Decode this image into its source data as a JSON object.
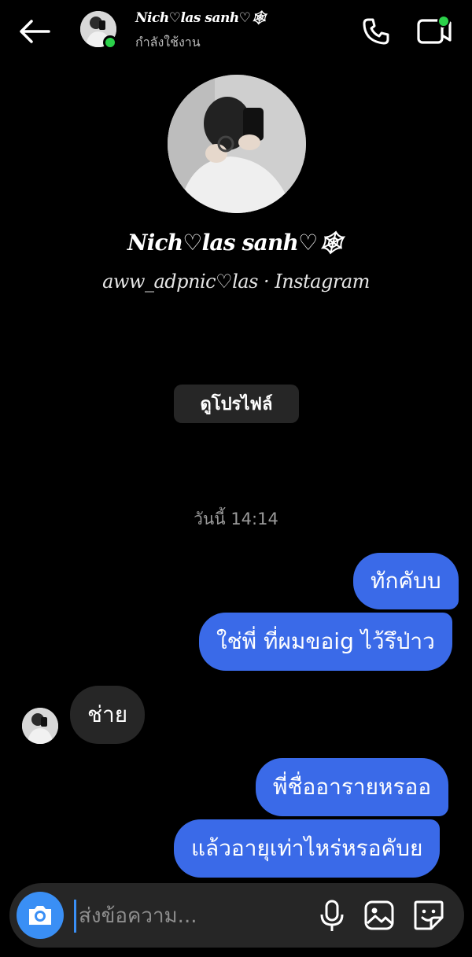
{
  "header": {
    "name": "Nich♡las sanh♡🕸",
    "status": "กำลังใช้งาน",
    "icons": {
      "back": "back-arrow-icon",
      "call": "phone-icon",
      "video": "video-call-icon"
    }
  },
  "profile": {
    "name": "Nich♡las sanh♡🕸",
    "subtitle": "aww_adpnic♡las · Instagram",
    "view_profile_label": "ดูโปรไฟล์"
  },
  "timestamp": "วันนี้ 14:14",
  "messages": [
    {
      "from": "me",
      "text": "ทักคับบ"
    },
    {
      "from": "me",
      "text": "ใช่พี่ ที่ผมขอig ไว้รึป่าว"
    },
    {
      "from": "them",
      "text": "ช่าย"
    },
    {
      "from": "me",
      "text": "พี่ชื่ออารายหรออ"
    },
    {
      "from": "me",
      "text": "แล้วอายุเท่าไหร่หรอคับย"
    }
  ],
  "composer": {
    "placeholder": "ส่งข้อความ...",
    "icons": {
      "camera": "camera-icon",
      "mic": "microphone-icon",
      "gallery": "gallery-icon",
      "sticker": "sticker-icon"
    }
  },
  "colors": {
    "outgoing": "#3a6ae8",
    "incoming": "#262626",
    "online": "#2bd14a",
    "accent": "#3a8ff5"
  }
}
